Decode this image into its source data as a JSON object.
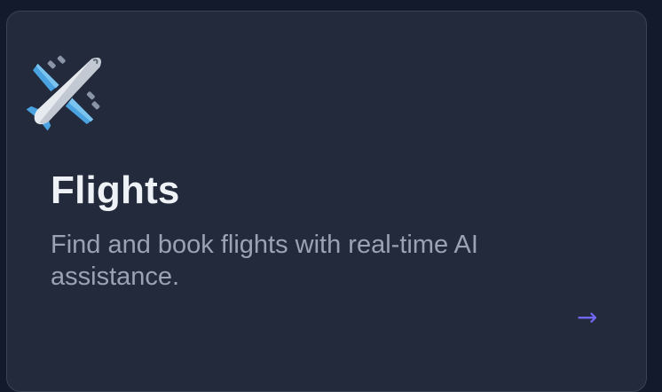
{
  "card": {
    "icon": "airplane-icon",
    "title": "Flights",
    "description": "Find and book flights with real-time AI assistance.",
    "arrow": "→"
  },
  "colors": {
    "background": "#121a2c",
    "card": "#222a3b",
    "border": "#3a4354",
    "title": "#eef1f6",
    "description": "#9aa3b2",
    "accent": "#6f67f0"
  }
}
